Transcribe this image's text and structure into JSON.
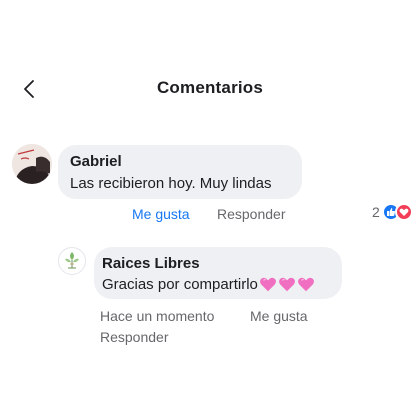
{
  "header": {
    "title": "Comentarios",
    "back_icon": "chevron-left-icon"
  },
  "comments": [
    {
      "author": "Gabriel",
      "text": "Las recibieron hoy. Muy lindas",
      "avatar_text": "NUNCA MÁS",
      "actions": {
        "like": "Me gusta",
        "reply": "Responder"
      },
      "reactions": {
        "count": "2",
        "icons": [
          "like-reaction-icon",
          "love-reaction-icon"
        ]
      }
    },
    {
      "author": "Raices Libres",
      "text": "Gracias por compartirlo",
      "emoji": [
        "pink-heart-icon",
        "pink-heart-icon",
        "pink-heart-icon"
      ],
      "actions": {
        "time": "Hace un momento",
        "like": "Me gusta",
        "reply": "Responder"
      }
    }
  ],
  "colors": {
    "bubble": "#eef0f3",
    "link_blue": "#1877f2",
    "secondary_text": "#65676b",
    "heart_pink": "#f06fc0"
  }
}
